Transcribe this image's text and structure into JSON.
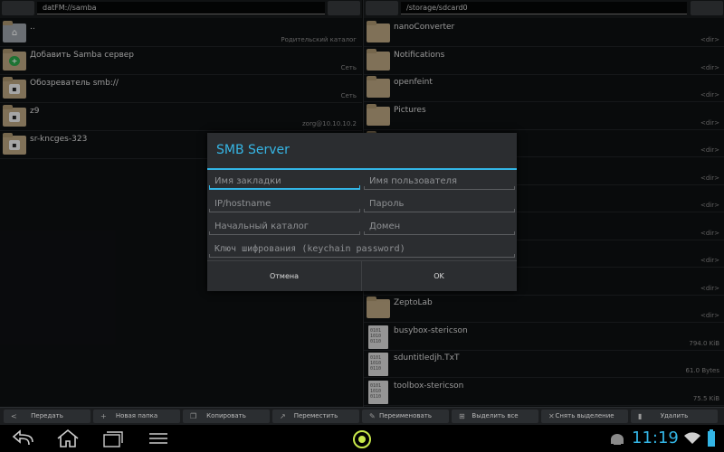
{
  "left_pane": {
    "path": "datFM://samba",
    "items": [
      {
        "name": "..",
        "meta": "Родительский каталог",
        "icon": "home-icon"
      },
      {
        "name": "Добавить Samba сервер",
        "meta": "Сеть",
        "icon": "add-folder-icon"
      },
      {
        "name": "Обозреватель smb://",
        "meta": "Сеть",
        "icon": "network-folder-icon"
      },
      {
        "name": "z9",
        "meta": "zorg@10.10.10.2",
        "icon": "network-folder-icon"
      },
      {
        "name": "sr-kncges-323",
        "meta": "",
        "icon": "network-folder-icon"
      }
    ]
  },
  "right_pane": {
    "path": "/storage/sdcard0",
    "items": [
      {
        "name": "nanoConverter",
        "meta": "<dir>",
        "type": "folder"
      },
      {
        "name": "Notifications",
        "meta": "<dir>",
        "type": "folder"
      },
      {
        "name": "openfeint",
        "meta": "<dir>",
        "type": "folder"
      },
      {
        "name": "Pictures",
        "meta": "<dir>",
        "type": "folder"
      },
      {
        "name": "",
        "meta": "<dir>",
        "type": "folder"
      },
      {
        "name": "",
        "meta": "<dir>",
        "type": "folder"
      },
      {
        "name": "",
        "meta": "<dir>",
        "type": "folder"
      },
      {
        "name": "",
        "meta": "<dir>",
        "type": "folder"
      },
      {
        "name": "",
        "meta": "<dir>",
        "type": "folder"
      },
      {
        "name": "",
        "meta": "<dir>",
        "type": "folder"
      },
      {
        "name": "ZeptoLab",
        "meta": "<dir>",
        "type": "folder"
      },
      {
        "name": "busybox-stericson",
        "meta": "794.0 KiB",
        "type": "file"
      },
      {
        "name": "sduntitledjh.TxT",
        "meta": "61.0 Bytes",
        "type": "file"
      },
      {
        "name": "toolbox-stericson",
        "meta": "75.5 KiB",
        "type": "file"
      }
    ]
  },
  "dialog": {
    "title": "SMB Server",
    "fields": {
      "bookmark_name": "Имя закладки",
      "username": "Имя пользователя",
      "host": "IP/hostname",
      "password": "Пароль",
      "start_dir": "Начальный каталог",
      "domain": "Домен",
      "keychain": "Ключ шифрования (keychain password)"
    },
    "cancel": "Отмена",
    "ok": "OK"
  },
  "toolbar": [
    {
      "label": "Передать",
      "icon": "share-icon"
    },
    {
      "label": "Новая папка",
      "icon": "plus-icon"
    },
    {
      "label": "Копировать",
      "icon": "copy-icon"
    },
    {
      "label": "Переместить",
      "icon": "move-icon"
    },
    {
      "label": "Переименовать",
      "icon": "pencil-icon"
    },
    {
      "label": "Выделить все",
      "icon": "select-all-icon"
    },
    {
      "label": "Снять выделение",
      "icon": "deselect-icon"
    },
    {
      "label": "Удалить",
      "icon": "trash-icon"
    }
  ],
  "status": {
    "time": "11:19"
  },
  "colors": {
    "accent": "#33b5e5",
    "folder": "#b8a27e"
  }
}
